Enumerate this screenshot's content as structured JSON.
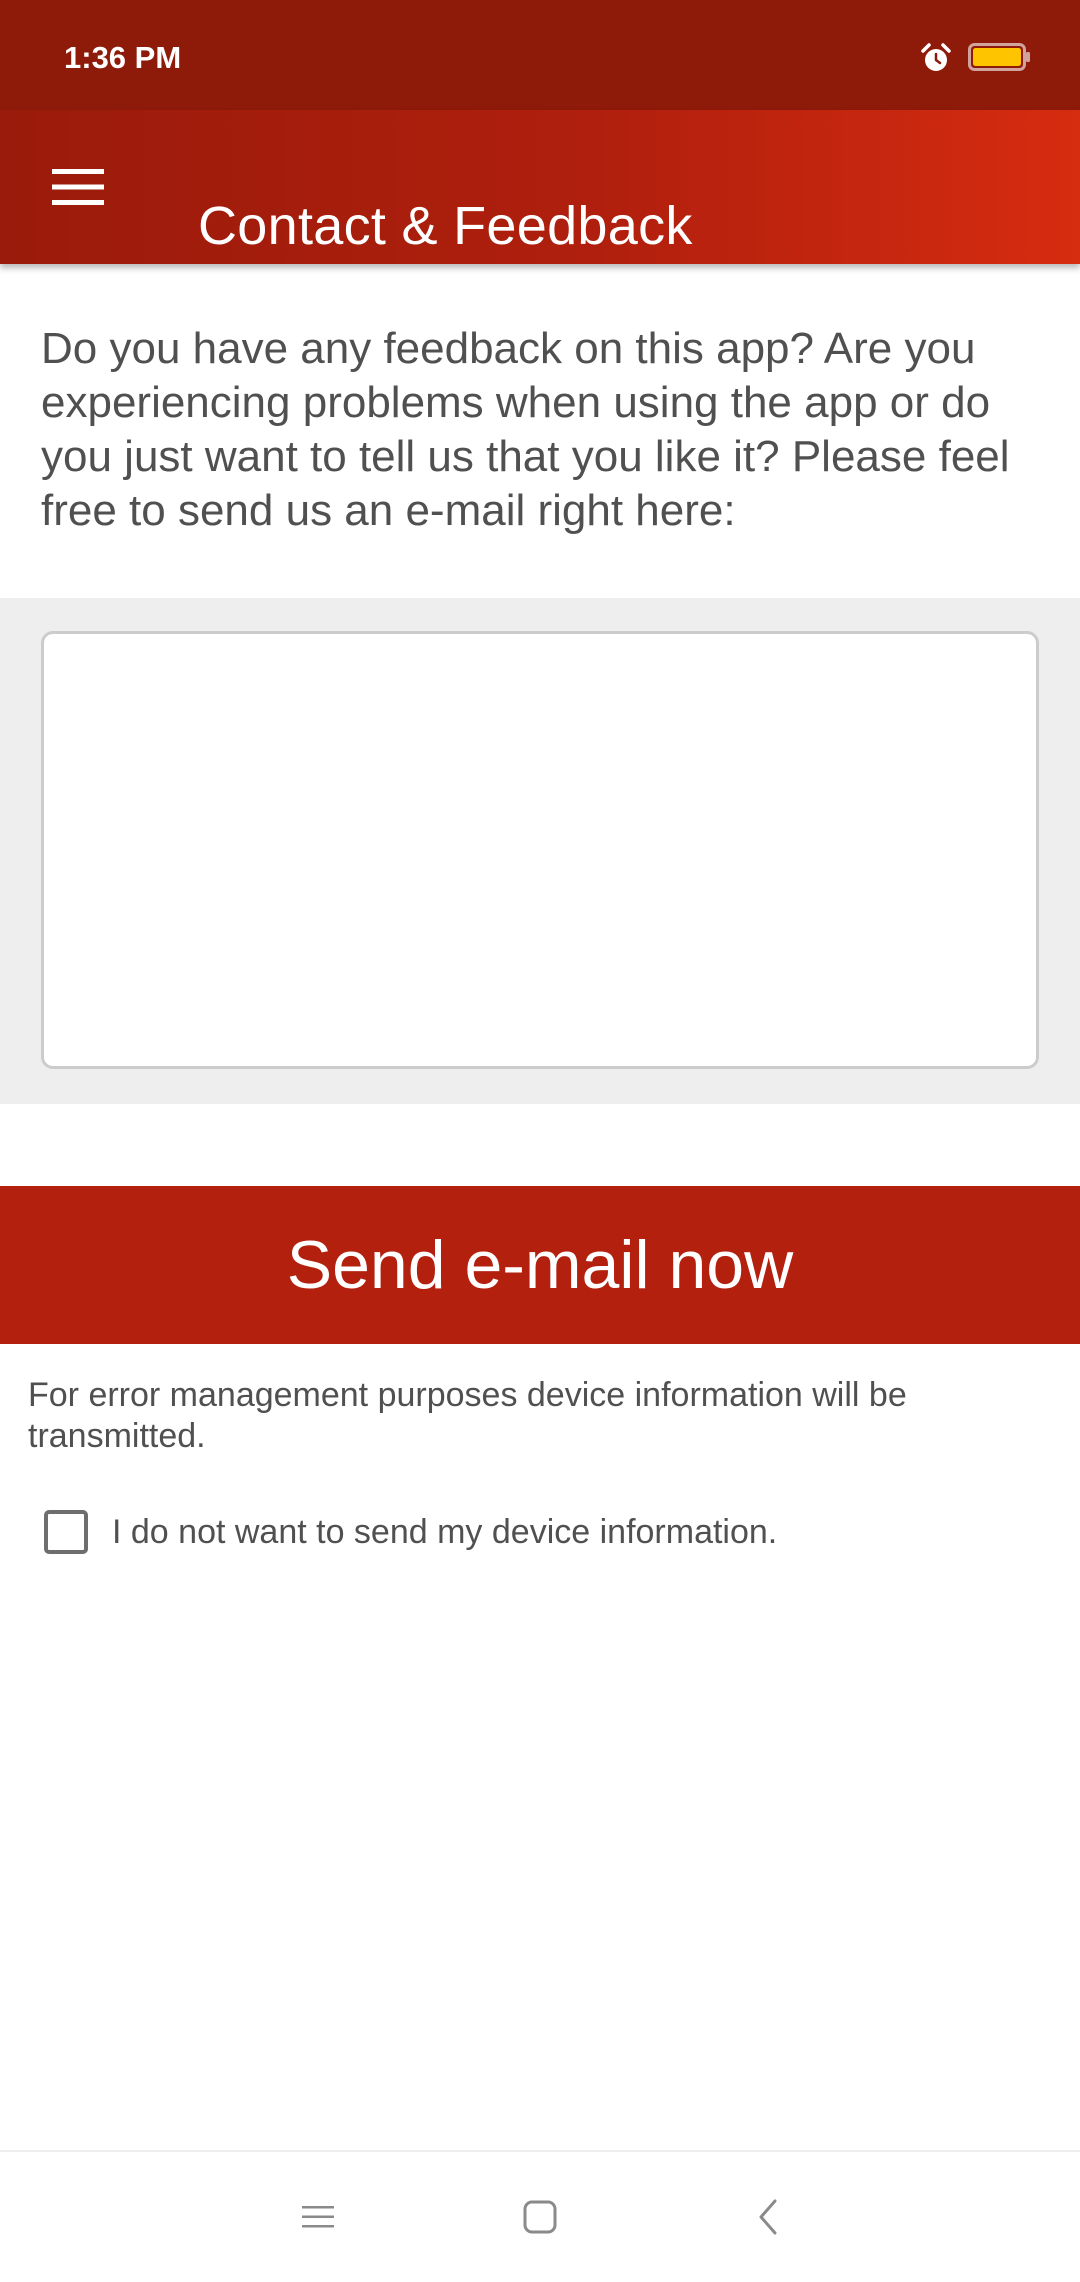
{
  "status_bar": {
    "time": "1:36 PM",
    "icons": [
      "alarm-icon",
      "battery-icon"
    ],
    "battery_color": "#ffc400"
  },
  "app_bar": {
    "title": "Contact & Feedback",
    "menu_icon": "hamburger-menu-icon"
  },
  "main": {
    "intro": "Do you have any feedback on this app? Are you experiencing problems when using the app or do you just want to tell us that you like it? Please feel free to send us an e-mail right here:",
    "message": {
      "value": "",
      "placeholder": ""
    },
    "send_button_label": "Send e-mail now",
    "info": "For error management purposes device information will be transmitted.",
    "opt_out": {
      "label": "I do not want to send my device information.",
      "checked": false
    }
  },
  "nav_bar": {
    "icons": [
      "recent-apps-icon",
      "home-icon",
      "back-icon"
    ]
  },
  "colors": {
    "status_bar": "#8e1a0a",
    "app_bar_start": "#9a1b0b",
    "app_bar_end": "#d62c10",
    "accent": "#b3200e",
    "text": "#505050",
    "input_area_bg": "#eeeeee"
  }
}
